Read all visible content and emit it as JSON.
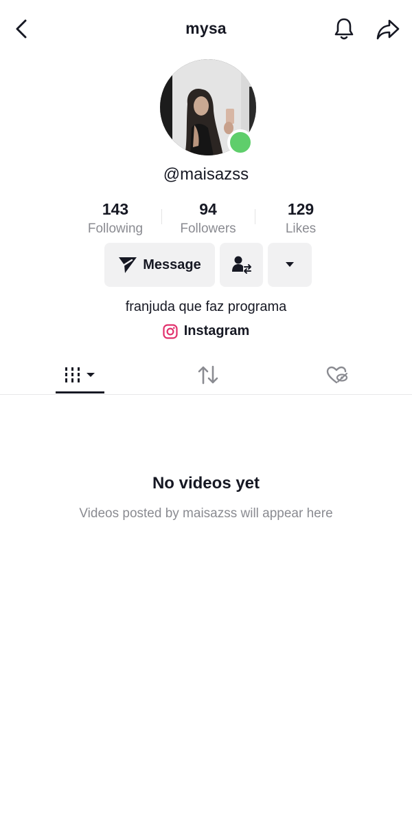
{
  "header": {
    "title": "mysa",
    "icons": {
      "back": "chevron-left-icon",
      "notifications": "bell-icon",
      "share": "share-arrow-icon"
    }
  },
  "profile": {
    "username": "@maisazss",
    "online": true,
    "online_color": "#5fce6b",
    "stats": [
      {
        "value": "143",
        "label": "Following"
      },
      {
        "value": "94",
        "label": "Followers"
      },
      {
        "value": "129",
        "label": "Likes"
      }
    ],
    "buttons": {
      "message_label": "Message",
      "friends_icon": "add-friend-swap-icon",
      "more_icon": "caret-down-icon"
    },
    "bio": "franjuda que faz programa",
    "link": {
      "icon": "instagram-icon",
      "label": "Instagram",
      "color": "#e1306c"
    }
  },
  "tabs": {
    "items": [
      "videos-grid-icon",
      "repost-icon",
      "liked-hidden-icon"
    ],
    "active": 0
  },
  "empty_state": {
    "title": "No videos yet",
    "subtitle": "Videos posted by maisazss will appear here"
  }
}
